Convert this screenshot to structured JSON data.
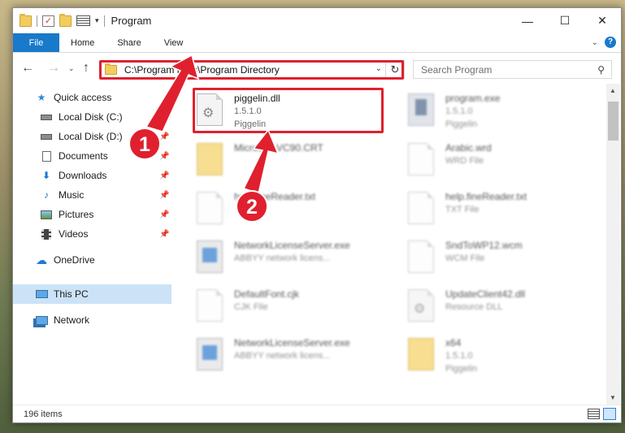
{
  "window": {
    "title": "Program",
    "controls": {
      "minimize": "—",
      "maximize": "☐",
      "close": "✕"
    }
  },
  "ribbon": {
    "tabs": [
      {
        "label": "File"
      },
      {
        "label": "Home"
      },
      {
        "label": "Share"
      },
      {
        "label": "View"
      }
    ],
    "help": "?"
  },
  "address": {
    "path": "C:\\Program Files\\Program Directory",
    "search_placeholder": "Search Program"
  },
  "nav": {
    "quick_access": "Quick access",
    "items": [
      {
        "label": "Local Disk (C:)",
        "icon": "drive-icon"
      },
      {
        "label": "Local Disk (D:)",
        "icon": "drive-icon"
      },
      {
        "label": "Documents",
        "icon": "documents-icon"
      },
      {
        "label": "Downloads",
        "icon": "downloads-icon"
      },
      {
        "label": "Music",
        "icon": "music-icon"
      },
      {
        "label": "Pictures",
        "icon": "pictures-icon"
      },
      {
        "label": "Videos",
        "icon": "videos-icon"
      }
    ],
    "onedrive": "OneDrive",
    "this_pc": "This PC",
    "network": "Network"
  },
  "files": [
    {
      "name": "piggelin.dll",
      "line2": "1.5.1.0",
      "line3": "Piggelin"
    },
    {
      "name": "program.exe",
      "line2": "1.5.1.0",
      "line3": "Piggelin"
    },
    {
      "name": "Microsoft.VC90.CRT",
      "line2": "",
      "line3": ""
    },
    {
      "name": "Arabic.wrd",
      "line2": "WRD File",
      "line3": ""
    },
    {
      "name": "help.fineReader.txt",
      "line2": "",
      "line3": ""
    },
    {
      "name": "help.fineReader.txt",
      "line2": "TXT File",
      "line3": ""
    },
    {
      "name": "NetworkLicenseServer.exe",
      "line2": "ABBYY network licens...",
      "line3": ""
    },
    {
      "name": "SndToWP12.wcm",
      "line2": "WCM File",
      "line3": ""
    },
    {
      "name": "DefaultFont.cjk",
      "line2": "CJK File",
      "line3": ""
    },
    {
      "name": "UpdateClient42.dll",
      "line2": "Resource DLL",
      "line3": ""
    },
    {
      "name": "NetworkLicenseServer.exe",
      "line2": "ABBYY network licens...",
      "line3": ""
    },
    {
      "name": "x64",
      "line2": "1.5.1.0",
      "line3": "Piggelin"
    }
  ],
  "status": {
    "count": "196 items"
  },
  "annotations": {
    "step1": "1",
    "step2": "2",
    "color": "#e0202e"
  }
}
